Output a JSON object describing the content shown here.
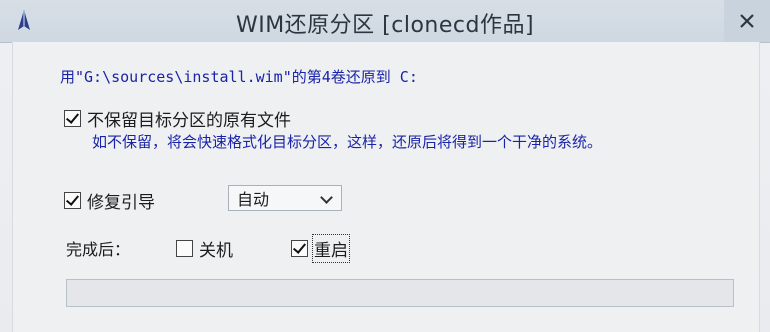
{
  "window": {
    "title": "WIM还原分区  [clonecd作品]",
    "icon": "app-icon",
    "close_icon": "close-icon"
  },
  "info": {
    "text": "用\"G:\\sources\\install.wim\"的第4卷还原到 C:"
  },
  "options": {
    "keep_files": {
      "label": "不保留目标分区的原有文件",
      "checked": true,
      "hint": "如不保留，将会快速格式化目标分区，这样，还原后将得到一个干净的系统。"
    },
    "repair_boot": {
      "label": "修复引导",
      "checked": true,
      "mode_selected": "自动"
    }
  },
  "after": {
    "label": "完成后：",
    "shutdown_label": "关机",
    "shutdown_checked": false,
    "restart_label": "重启",
    "restart_checked": true
  },
  "progress": {
    "fraction": 0
  },
  "colors": {
    "info_text": "#1a24a8",
    "hint_text": "#1a24a8"
  }
}
